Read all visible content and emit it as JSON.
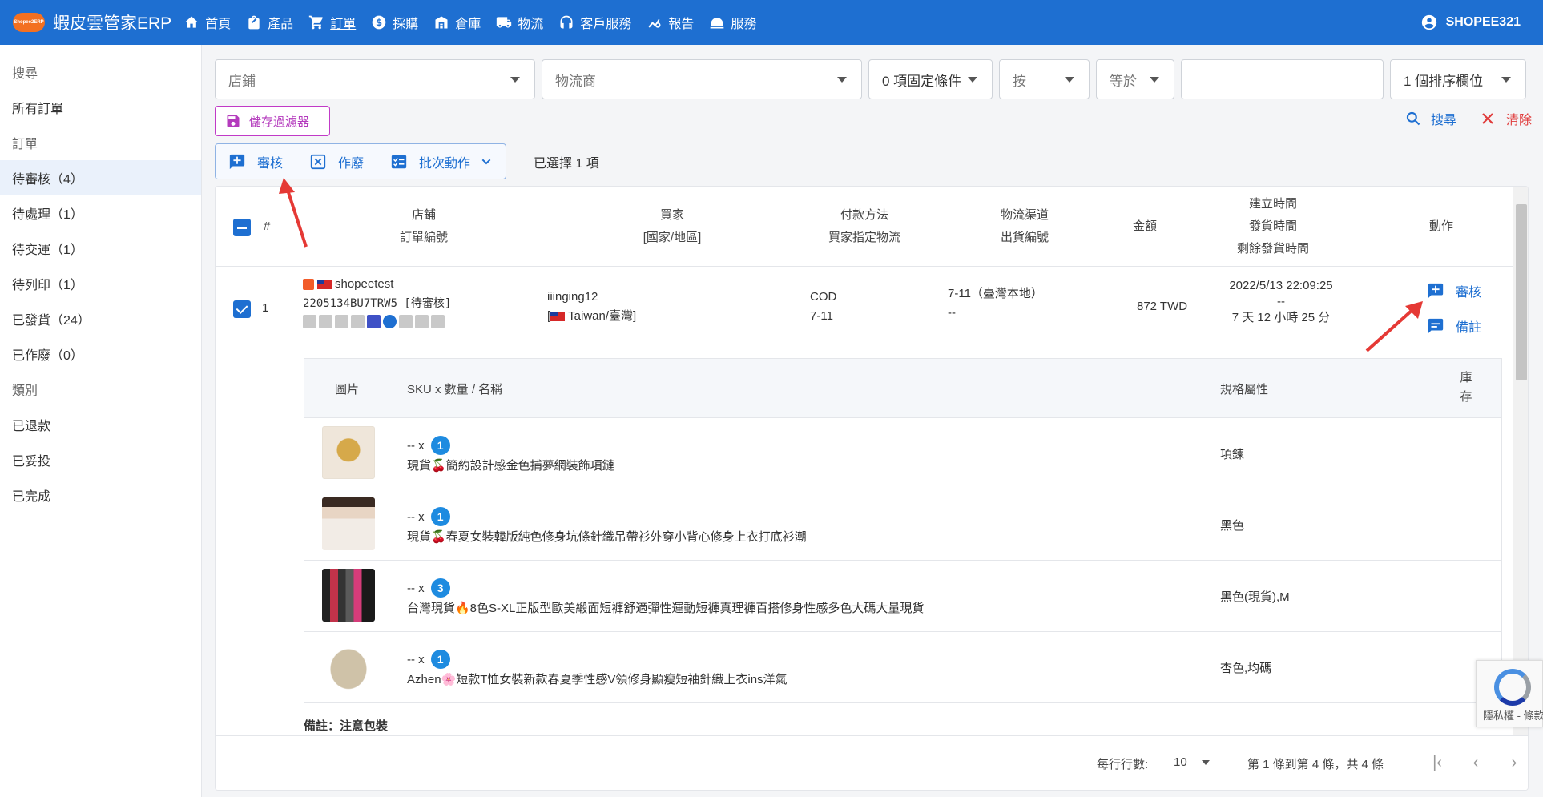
{
  "brand": {
    "logo_text": "Shopee2ERP",
    "name": "蝦皮雲管家ERP"
  },
  "nav": [
    {
      "label": "首頁",
      "icon": "home-icon"
    },
    {
      "label": "產品",
      "icon": "bag-icon"
    },
    {
      "label": "訂單",
      "icon": "cart-icon"
    },
    {
      "label": "採購",
      "icon": "dollar-icon"
    },
    {
      "label": "倉庫",
      "icon": "warehouse-icon"
    },
    {
      "label": "物流",
      "icon": "truck-icon"
    },
    {
      "label": "客戶服務",
      "icon": "headset-icon"
    },
    {
      "label": "報告",
      "icon": "chart-icon"
    },
    {
      "label": "服務",
      "icon": "service-bell-icon"
    }
  ],
  "user": {
    "name": "SHOPEE321"
  },
  "sidebar": [
    {
      "label": "搜尋",
      "head": true
    },
    {
      "label": "所有訂單"
    },
    {
      "label": "訂單",
      "head": true
    },
    {
      "label": "待審核（4）",
      "active": true
    },
    {
      "label": "待處理（1）"
    },
    {
      "label": "待交運（1）"
    },
    {
      "label": "待列印（1）"
    },
    {
      "label": "已發貨（24）"
    },
    {
      "label": "已作廢（0）"
    },
    {
      "label": "類別",
      "head": true
    },
    {
      "label": "已退款"
    },
    {
      "label": "已妥投"
    },
    {
      "label": "已完成"
    }
  ],
  "filters": {
    "shop": "店鋪",
    "logistics": "物流商",
    "conditions": "0 項固定條件",
    "by": "按",
    "equals": "等於",
    "value": "",
    "sort": "1 個排序欄位"
  },
  "save_filter": "儲存過濾器",
  "search": "搜尋",
  "clear": "清除",
  "actions": {
    "approve": "審核",
    "void": "作廢",
    "batch": "批次動作"
  },
  "selected": "已選擇 1 項",
  "table": {
    "headers": {
      "index": "#",
      "shop": "店鋪",
      "order_no": "訂單編號",
      "buyer": "買家",
      "region": "[國家/地區]",
      "payment": "付款方法",
      "buyer_logistics": "買家指定物流",
      "channel": "物流渠道",
      "ship_no": "出貨編號",
      "amount": "金額",
      "created": "建立時間",
      "shipped": "發貨時間",
      "remaining": "剩餘發貨時間",
      "action": "動作"
    },
    "row": {
      "index": "1",
      "shop": "shopeetest",
      "order_no": "2205134BU7TRW5 [待審核]",
      "buyer": "iiinging12",
      "region": "Taiwan/臺灣",
      "payment": "COD",
      "buyer_logistics": "7-11",
      "channel": "7-11（臺灣本地）",
      "ship_no": "--",
      "amount": "872  TWD",
      "created": "2022/5/13 22:09:25",
      "shipped": "--",
      "remaining": "7 天 12 小時 25 分",
      "approve": "審核",
      "note": "備註"
    }
  },
  "items_table": {
    "headers": {
      "image": "圖片",
      "sku": "SKU x 數量 / 名稱",
      "spec": "規格屬性",
      "stock": "庫存"
    },
    "items": [
      {
        "sku": "-- x",
        "qty": "1",
        "name": "現貨🍒簡約設計感金色捕夢網裝飾項鏈",
        "spec": "項鍊"
      },
      {
        "sku": "-- x",
        "qty": "1",
        "name": "現貨🍒春夏女裝韓版純色修身坑條針織吊帶衫外穿小背心修身上衣打底衫潮",
        "spec": "黑色"
      },
      {
        "sku": "-- x",
        "qty": "3",
        "name": "台灣現貨🔥8色S-XL正版型歐美緞面短褲舒適彈性運動短褲真理褲百搭修身性感多色大碼大量現貨",
        "spec": "黑色(現貨),M"
      },
      {
        "sku": "-- x",
        "qty": "1",
        "name": "Azhen🌸短款T恤女裝新款春夏季性感V領修身顯瘦短袖針織上衣ins洋氣",
        "spec": "杏色,均碼"
      }
    ],
    "note": "備註：注意包裝"
  },
  "pager": {
    "rows_label": "每行行數:",
    "rows_value": "10",
    "range": "第 1 條到第 4 條，共 4 條"
  },
  "recaptcha": {
    "text": "隱私權 - 條款"
  },
  "colors": {
    "primary": "#1e6fd1",
    "accent": "#b43bbd",
    "danger": "#e03b3b",
    "annotation": "#e53935"
  }
}
